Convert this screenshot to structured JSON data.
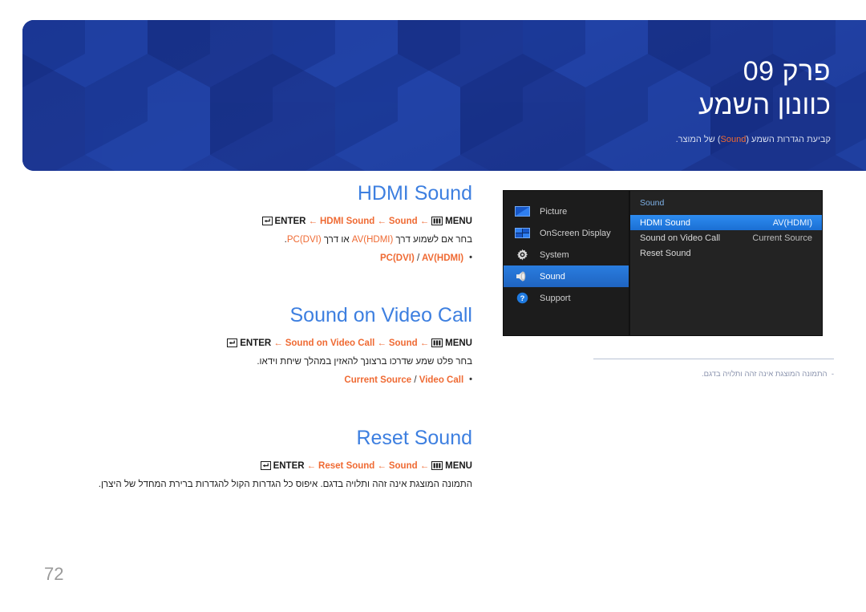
{
  "banner": {
    "chapter_label": "פרק 09",
    "chapter_title": "כוונון השמע",
    "subtitle_before": "קביעת הגדרות השמע (",
    "subtitle_highlight": "Sound",
    "subtitle_after": ") של המוצר.",
    "bg_color": "#1e3a99"
  },
  "sections": [
    {
      "title": "HDMI Sound",
      "crumb": {
        "menu_icon": "menu-icon",
        "menu_label": "MENU",
        "arrow": "←",
        "step1": "Sound",
        "step2": "HDMI Sound",
        "enter_icon": "enter-icon",
        "enter_label": "ENTER"
      },
      "body_rtl_a": "בחר אם לשמוע דרך ",
      "body_en_1": "AV(HDMI)",
      "body_rtl_b": " או דרך ",
      "body_en_2": "PC(DVI)",
      "body_rtl_c": ".",
      "bullet": "PC(DVI) / AV(HDMI)",
      "bullet_parts": [
        "PC(DVI)",
        "/",
        "AV(HDMI)"
      ]
    },
    {
      "title": "Sound on Video Call",
      "crumb": {
        "menu_icon": "menu-icon",
        "menu_label": "MENU",
        "arrow": "←",
        "step1": "Sound",
        "step2": "Sound on Video Call",
        "enter_icon": "enter-icon",
        "enter_label": "ENTER"
      },
      "body_full": "בחר פלט שמע שדרכו ברצונך להאזין במהלך שיחת וידאו.",
      "bullet_parts": [
        "Video Call",
        "/",
        "Current Source"
      ]
    },
    {
      "title": "Reset Sound",
      "crumb": {
        "menu_icon": "menu-icon",
        "menu_label": "MENU",
        "arrow": "←",
        "step1": "Sound",
        "step2": "Reset Sound",
        "enter_icon": "enter-icon",
        "enter_label": "ENTER"
      },
      "body_full": "התמונה המוצגת אינה זהה ותלויה בדגם. איפוס כל הגדרות הקול להגדרות ברירת המחדל של היצרן."
    }
  ],
  "osd": {
    "sidebar": [
      {
        "label": "Picture",
        "icon": "picture-icon",
        "selected": false
      },
      {
        "label": "OnScreen Display",
        "icon": "onscreen-display-icon",
        "selected": false
      },
      {
        "label": "System",
        "icon": "gear-icon",
        "selected": false
      },
      {
        "label": "Sound",
        "icon": "speaker-icon",
        "selected": true
      },
      {
        "label": "Support",
        "icon": "question-circle-icon",
        "selected": false
      }
    ],
    "panel_title": "Sound",
    "rows": [
      {
        "label": "HDMI Sound",
        "value": "AV(HDMI)",
        "highlighted": true
      },
      {
        "label": "Sound on Video Call",
        "value": "Current Source",
        "highlighted": false
      },
      {
        "label": "Reset Sound",
        "value": "",
        "highlighted": false
      }
    ],
    "highlight_color": "#2e8cf0",
    "bg_color": "#1a1a1a"
  },
  "note": {
    "dash": "-",
    "text": "התמונה המוצגת אינה זהה ותלויה בדגם."
  },
  "page_number": "72"
}
